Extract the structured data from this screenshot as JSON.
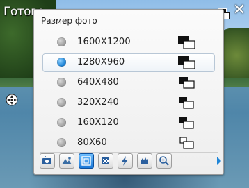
{
  "header": {
    "done_label": "Готово",
    "top_res_icon": "resolution-1280x960-icon",
    "close_icon": "close-icon"
  },
  "dialog": {
    "title": "Размер фото",
    "options": [
      {
        "label": "1600X1200",
        "icon": "resolution-1600x1200-icon",
        "selected": false
      },
      {
        "label": "1280X960",
        "icon": "resolution-1280x960-icon",
        "selected": true
      },
      {
        "label": "640X480",
        "icon": "resolution-640x480-icon",
        "selected": false
      },
      {
        "label": "320X240",
        "icon": "resolution-320x240-icon",
        "selected": false
      },
      {
        "label": "160X120",
        "icon": "resolution-160x120-icon",
        "selected": false
      },
      {
        "label": "80X60",
        "icon": "resolution-80x60-icon",
        "selected": false
      }
    ]
  },
  "toolbar": {
    "tools": [
      {
        "name": "capture-mode-icon",
        "active": false
      },
      {
        "name": "scene-landscape-icon",
        "active": false
      },
      {
        "name": "photo-size-icon",
        "active": true
      },
      {
        "name": "quality-icon",
        "active": false
      },
      {
        "name": "flash-icon",
        "active": false
      },
      {
        "name": "white-balance-icon",
        "active": false
      },
      {
        "name": "zoom-icon",
        "active": false
      }
    ],
    "more_icon": "chevron-right-icon"
  },
  "side": {
    "nav_icon": "navigation-pad-icon"
  },
  "colors": {
    "accent": "#1f86d8",
    "panel": "#f4f4f4",
    "border": "#9a9a9a"
  }
}
